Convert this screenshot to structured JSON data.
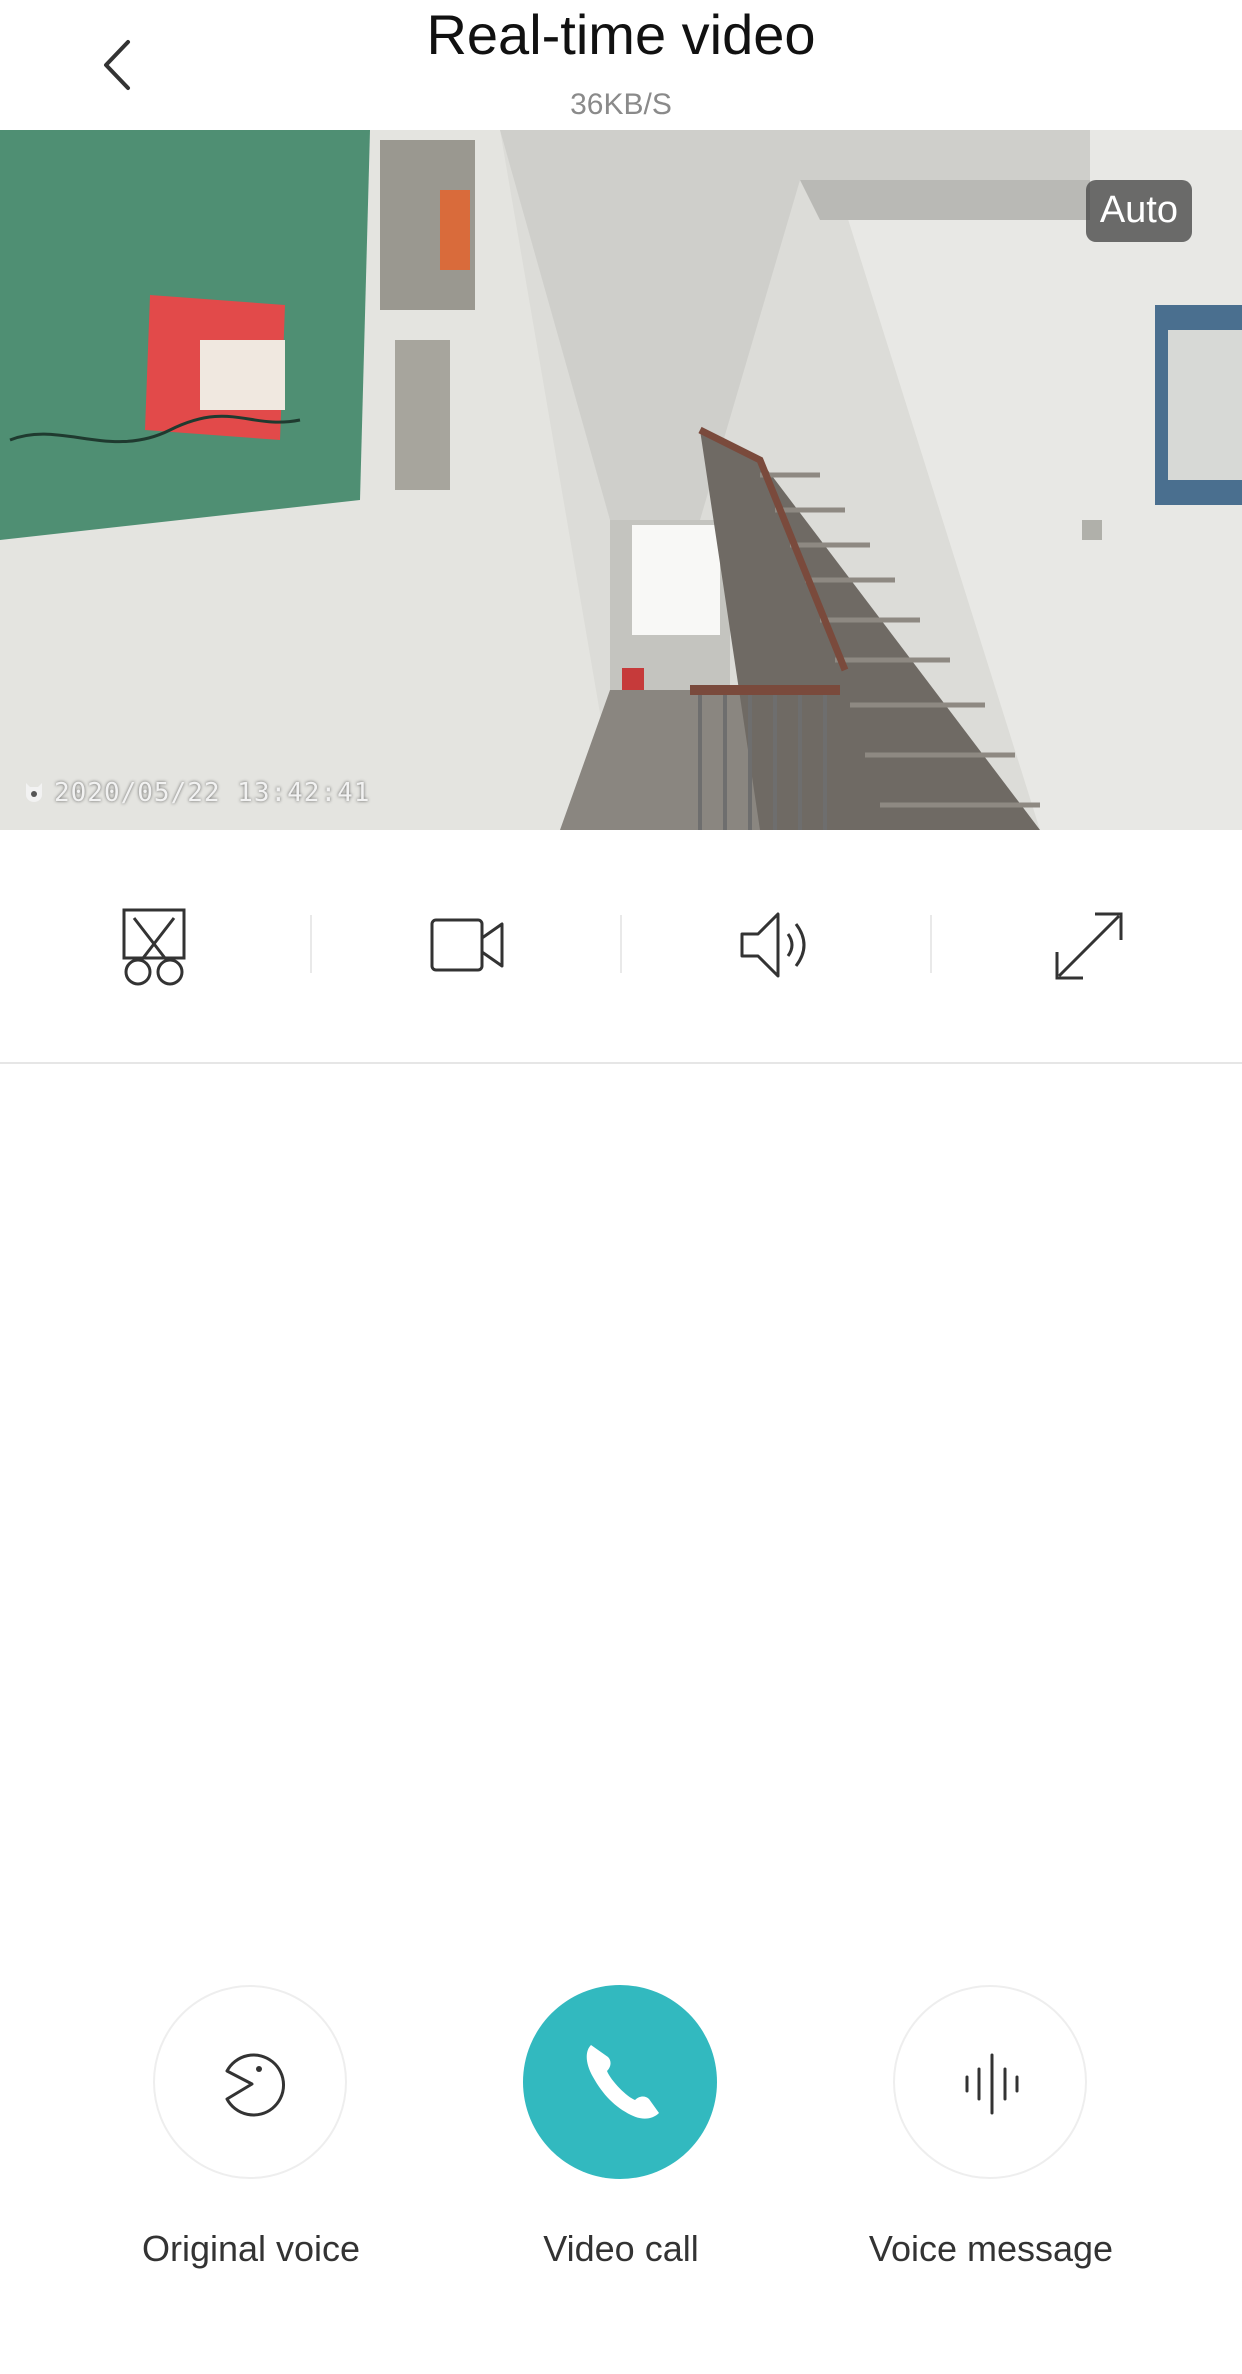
{
  "header": {
    "title": "Real-time video",
    "subtitle": "36KB/S",
    "back_icon": "chevron-left-icon"
  },
  "video": {
    "quality_label": "Auto",
    "timestamp": "2020/05/22  13:42:41",
    "watermark_icon": "camera-brand-icon"
  },
  "toolbar": {
    "items": [
      {
        "icon": "screenshot-scissors-icon"
      },
      {
        "icon": "record-video-icon"
      },
      {
        "icon": "speaker-icon"
      },
      {
        "icon": "fullscreen-icon"
      }
    ]
  },
  "actions": {
    "original_voice": {
      "label": "Original voice",
      "icon": "voice-effect-icon"
    },
    "video_call": {
      "label": "Video call",
      "icon": "phone-icon",
      "color": "#32b9bf"
    },
    "voice_message": {
      "label": "Voice message",
      "icon": "waveform-icon"
    }
  }
}
